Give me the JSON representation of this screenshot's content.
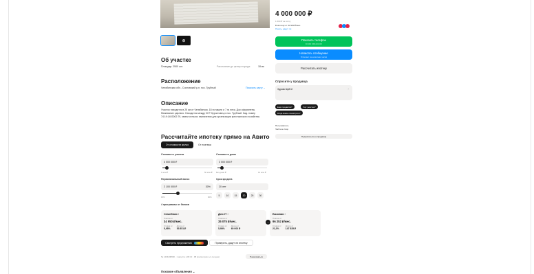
{
  "gallery": {
    "thumb_more_icon": "⊕"
  },
  "about": {
    "title": "Об участке",
    "area": "Площадь: 2500 сот.",
    "distance_label": "Расстояние до центра города:",
    "distance_value": "18 км"
  },
  "location": {
    "title": "Расположение",
    "address": "Челябинская обл., Сосновский р-н, пос. Трубный",
    "map_link": "Показать карту ⌄"
  },
  "description": {
    "title": "Описание",
    "text": "Участок находится в 25 км от Челябинска. 18 га пашни и 7 га леса. Док оформлены. Межевание сделано. Находится между СНТ Курчатовец и пос. Трубный. Кад. номер 74:19:1403002:79, земли сельхоз назначения для организации крестьянского хозяйства."
  },
  "mortgage": {
    "title": "Рассчитайте ипотеку прямо на Авито",
    "tab_active": "От стоимости жилья",
    "tab_other": "От платежа",
    "plot_cost_label": "Стоимость участка",
    "plot_cost_value": "4 000 000 ₽",
    "plot_min": "1 млн ₽",
    "plot_max": "50 млн ₽",
    "house_cost_label": "Стоимость дома",
    "house_cost_value": "3 000 000 ₽",
    "house_min": "Без дома ₽",
    "house_max": "10 млн ₽",
    "down_label": "Первоначальный взнос",
    "down_value": "2 100 000 ₽",
    "down_pct": "30%",
    "down_min": "15%",
    "down_max": "90%",
    "term_label": "Срок кредита",
    "term_value": "20 лет",
    "terms": [
      "5",
      "10",
      "15",
      "20",
      "25",
      "30"
    ],
    "term_active": "20",
    "programs_title": "4 программы от банков",
    "cards": [
      {
        "title": "Семейная ›",
        "pay_label": "Платёж от",
        "pay": "34 950 ₽/мес.",
        "rate_label": "Ставка от",
        "rate": "5,98%",
        "income_label": "Доход от",
        "income": "53 851 ₽"
      },
      {
        "title": "Для IT ›",
        "pay_label": "Платёж от",
        "pay": "35 075 ₽/мес.",
        "rate_label": "Ставка от",
        "rate": "5,98%",
        "income_label": "Доход от",
        "income": "60 000 ₽"
      },
      {
        "title": "Базовая ›",
        "pay_label": "Платёж от",
        "pay": "96 252 ₽/мес.",
        "rate_label": "Ставка от",
        "rate": "22,3%",
        "income_label": "Доход от",
        "income": "147 835 ₽"
      }
    ],
    "offers_button": "Смотреть предложения",
    "check_button": "Проверить, дадут ли ипотеку"
  },
  "meta": {
    "ad_info": "№ 1404208990 · 1 августа в 09:10 · 98 просмотров (+1 сегодня)",
    "report_button": "Пожаловаться"
  },
  "similar": {
    "title": "Похожие объявления ⌄"
  },
  "sidebar": {
    "price": "4 000 000 ₽",
    "per_unit": "1 600 ₽ за сотку",
    "mortgage_line": "В ипотеку от 34 950 ₽/мес.",
    "mortgage_link": "Узнать, дадут ли",
    "show_phone": "Показать телефон",
    "phone_mask": "8 XXX XXX-XX-XX",
    "write_message": "Написать сообщение",
    "message_note": "Отвечает за несколько часов",
    "calc_mortgage": "Рассчитать ипотеку",
    "ask_title": "Спросите у продавца",
    "ask_placeholder": "Здравствуйте!",
    "chips": [
      "Ещё продаётся?",
      "Торг уместен?",
      "Когда можно посмотреть?"
    ],
    "seller_type": "Пользователь",
    "seller_note": "Частное лицо",
    "subscribe": "Подписаться на продавца",
    "colors": {
      "green": "#00c35a",
      "blue": "#0a8cff",
      "accent": "#e3234b"
    }
  }
}
